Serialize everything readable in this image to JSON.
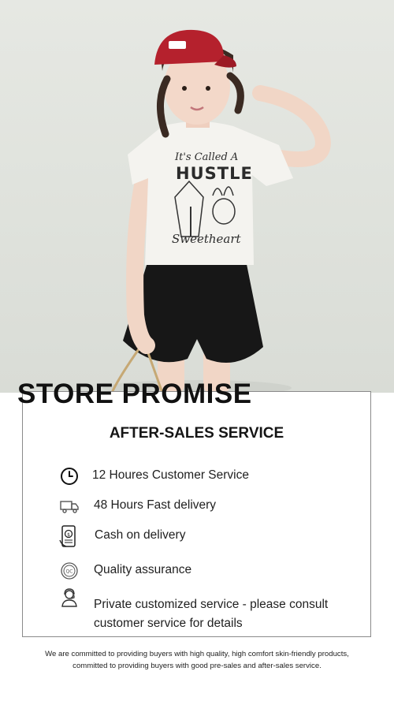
{
  "hero": {
    "shirt_text_top": "It's Called A",
    "shirt_text_main": "HUSTLE",
    "shirt_text_bottom": "Sweetheart"
  },
  "store": {
    "title": "STORE PROMISE"
  },
  "after_sales": {
    "title": "AFTER-SALES SERVICE",
    "items": [
      {
        "icon": "clock-icon",
        "label": "12 Houres Customer Service"
      },
      {
        "icon": "delivery-truck-icon",
        "label": "48 Hours Fast delivery"
      },
      {
        "icon": "cash-on-delivery-icon",
        "label": "Cash on delivery"
      },
      {
        "icon": "quality-badge-icon",
        "label": "Quality assurance"
      },
      {
        "icon": "customer-service-agent-icon",
        "label": "Private customized service - please consult customer service for details"
      }
    ]
  },
  "footer": {
    "line1": "We are committed to providing buyers with high quality, high comfort skin-friendly products,",
    "line2": "committed to providing buyers with good pre-sales and after-sales service."
  },
  "colors": {
    "cap": "#b5212d",
    "shirt": "#f4f3ef",
    "shorts": "#171717",
    "background": "#e1e4de"
  }
}
